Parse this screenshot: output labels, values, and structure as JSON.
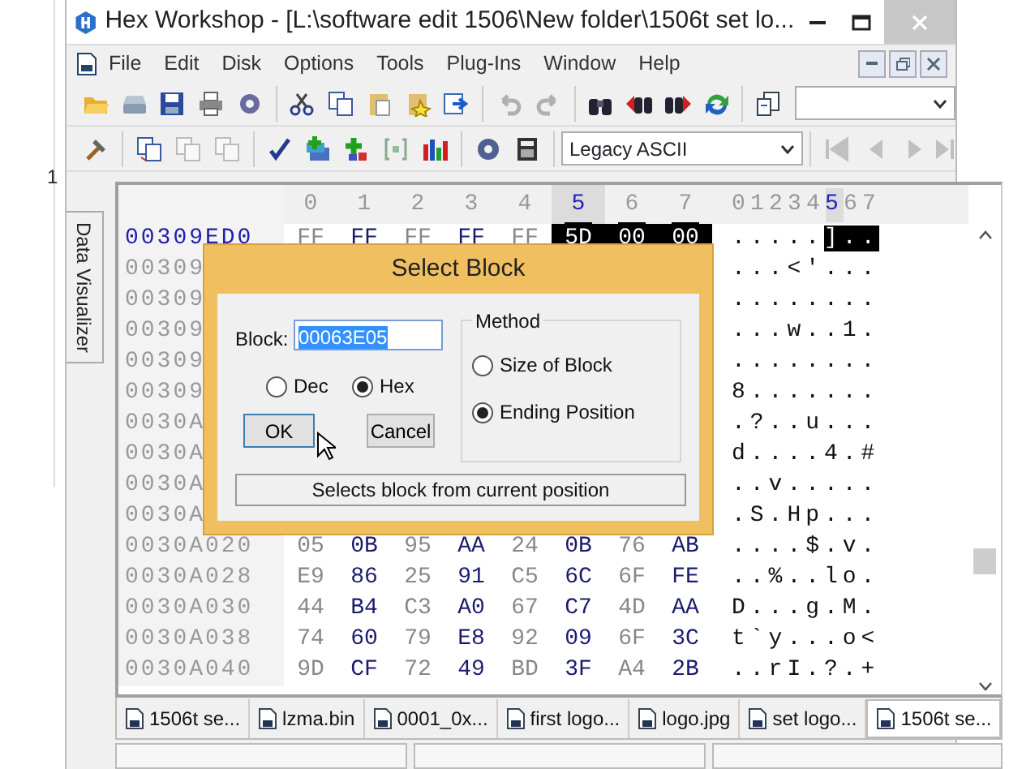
{
  "background_window": {
    "text": "1"
  },
  "window": {
    "title": "Hex Workshop - [L:\\software edit 1506\\New folder\\1506t set lo..."
  },
  "menu": [
    "File",
    "Edit",
    "Disk",
    "Options",
    "Tools",
    "Plug-Ins",
    "Window",
    "Help"
  ],
  "toolbar": {
    "encoding": "Legacy ASCII"
  },
  "side_tab": "Data Visualizer",
  "hex_columns": [
    {
      "label": "0",
      "selected": false
    },
    {
      "label": "1",
      "selected": false
    },
    {
      "label": "2",
      "selected": false
    },
    {
      "label": "3",
      "selected": false
    },
    {
      "label": "4",
      "selected": false
    },
    {
      "label": "5",
      "selected": true
    },
    {
      "label": "6",
      "selected": false
    },
    {
      "label": "7",
      "selected": false
    }
  ],
  "ascii_columns": [
    {
      "label": "0",
      "selected": false
    },
    {
      "label": "1",
      "selected": false
    },
    {
      "label": "2",
      "selected": false
    },
    {
      "label": "3",
      "selected": false
    },
    {
      "label": "4",
      "selected": false
    },
    {
      "label": "5",
      "selected": true
    },
    {
      "label": "6",
      "selected": false
    },
    {
      "label": "7",
      "selected": false
    }
  ],
  "rows": [
    {
      "address": "00309ED0",
      "current": true,
      "bytes": [
        {
          "text": "FF",
          "selected": false
        },
        {
          "text": "FF",
          "selected": false
        },
        {
          "text": "FF",
          "selected": false
        },
        {
          "text": "FF",
          "selected": false
        },
        {
          "text": "FF",
          "selected": false
        },
        {
          "text": "5D",
          "selected": true
        },
        {
          "text": "00",
          "selected": true
        },
        {
          "text": "00",
          "selected": true
        }
      ],
      "ascii": [
        {
          "text": ".....",
          "selected": false
        },
        {
          "text": "]..",
          "selected": true
        }
      ]
    },
    {
      "address": "00309",
      "current": false,
      "ascii": [
        {
          "text": "...<'...",
          "selected": false
        }
      ]
    },
    {
      "address": "00309",
      "current": false,
      "ascii": [
        {
          "text": "........",
          "selected": false
        }
      ]
    },
    {
      "address": "00309",
      "current": false,
      "ascii": [
        {
          "text": "...w..1.",
          "selected": false
        }
      ]
    },
    {
      "address": "00309",
      "current": false,
      "ascii": [
        {
          "text": "........",
          "selected": false
        }
      ]
    },
    {
      "address": "00309",
      "current": false,
      "ascii": [
        {
          "text": "8.......",
          "selected": false
        }
      ]
    },
    {
      "address": "0030A",
      "current": false,
      "ascii": [
        {
          "text": ".?..u...",
          "selected": false
        }
      ]
    },
    {
      "address": "0030A",
      "current": false,
      "ascii": [
        {
          "text": "d....4.#",
          "selected": false
        }
      ]
    },
    {
      "address": "0030A",
      "current": false,
      "ascii": [
        {
          "text": "..v.....",
          "selected": false
        }
      ]
    },
    {
      "address": "0030A",
      "current": false,
      "ascii": [
        {
          "text": ".S.Hp...",
          "selected": false
        }
      ]
    },
    {
      "address": "0030A020",
      "current": false,
      "bytes": [
        "05",
        "0B",
        "95",
        "AA",
        "24",
        "0B",
        "76",
        "AB"
      ],
      "ascii": [
        {
          "text": "....$.v.",
          "selected": false
        }
      ]
    },
    {
      "address": "0030A028",
      "current": false,
      "bytes": [
        "E9",
        "86",
        "25",
        "91",
        "C5",
        "6C",
        "6F",
        "FE"
      ],
      "ascii": [
        {
          "text": "..%..lo.",
          "selected": false
        }
      ]
    },
    {
      "address": "0030A030",
      "current": false,
      "bytes": [
        "44",
        "B4",
        "C3",
        "A0",
        "67",
        "C7",
        "4D",
        "AA"
      ],
      "ascii": [
        {
          "text": "D...g.M.",
          "selected": false
        }
      ]
    },
    {
      "address": "0030A038",
      "current": false,
      "bytes": [
        "74",
        "60",
        "79",
        "E8",
        "92",
        "09",
        "6F",
        "3C"
      ],
      "ascii": [
        {
          "text": "t`y...o<",
          "selected": false
        }
      ]
    },
    {
      "address": "0030A040",
      "current": false,
      "bytes": [
        "9D",
        "CF",
        "72",
        "49",
        "BD",
        "3F",
        "A4",
        "2B"
      ],
      "ascii": [
        {
          "text": "..rI.?.+",
          "selected": false
        }
      ]
    }
  ],
  "tabs": [
    {
      "label": "1506t se...",
      "selected": false
    },
    {
      "label": "lzma.bin",
      "selected": false
    },
    {
      "label": "0001_0x...",
      "selected": false
    },
    {
      "label": "first logo...",
      "selected": false
    },
    {
      "label": "logo.jpg",
      "selected": false
    },
    {
      "label": "set logo...",
      "selected": false
    },
    {
      "label": "1506t se...",
      "selected": true
    }
  ],
  "dialog": {
    "title": "Select Block",
    "block_label": "Block:",
    "block_value": "00063E05",
    "base": [
      {
        "label": "Dec",
        "selected": false
      },
      {
        "label": "Hex",
        "selected": true
      }
    ],
    "method_label": "Method",
    "method": [
      {
        "label": "Size of Block",
        "selected": false
      },
      {
        "label": "Ending Position",
        "selected": true
      }
    ],
    "buttons": [
      {
        "label": "OK",
        "default": true
      },
      {
        "label": "Cancel",
        "default": false
      }
    ],
    "status": "Selects block from current position"
  }
}
